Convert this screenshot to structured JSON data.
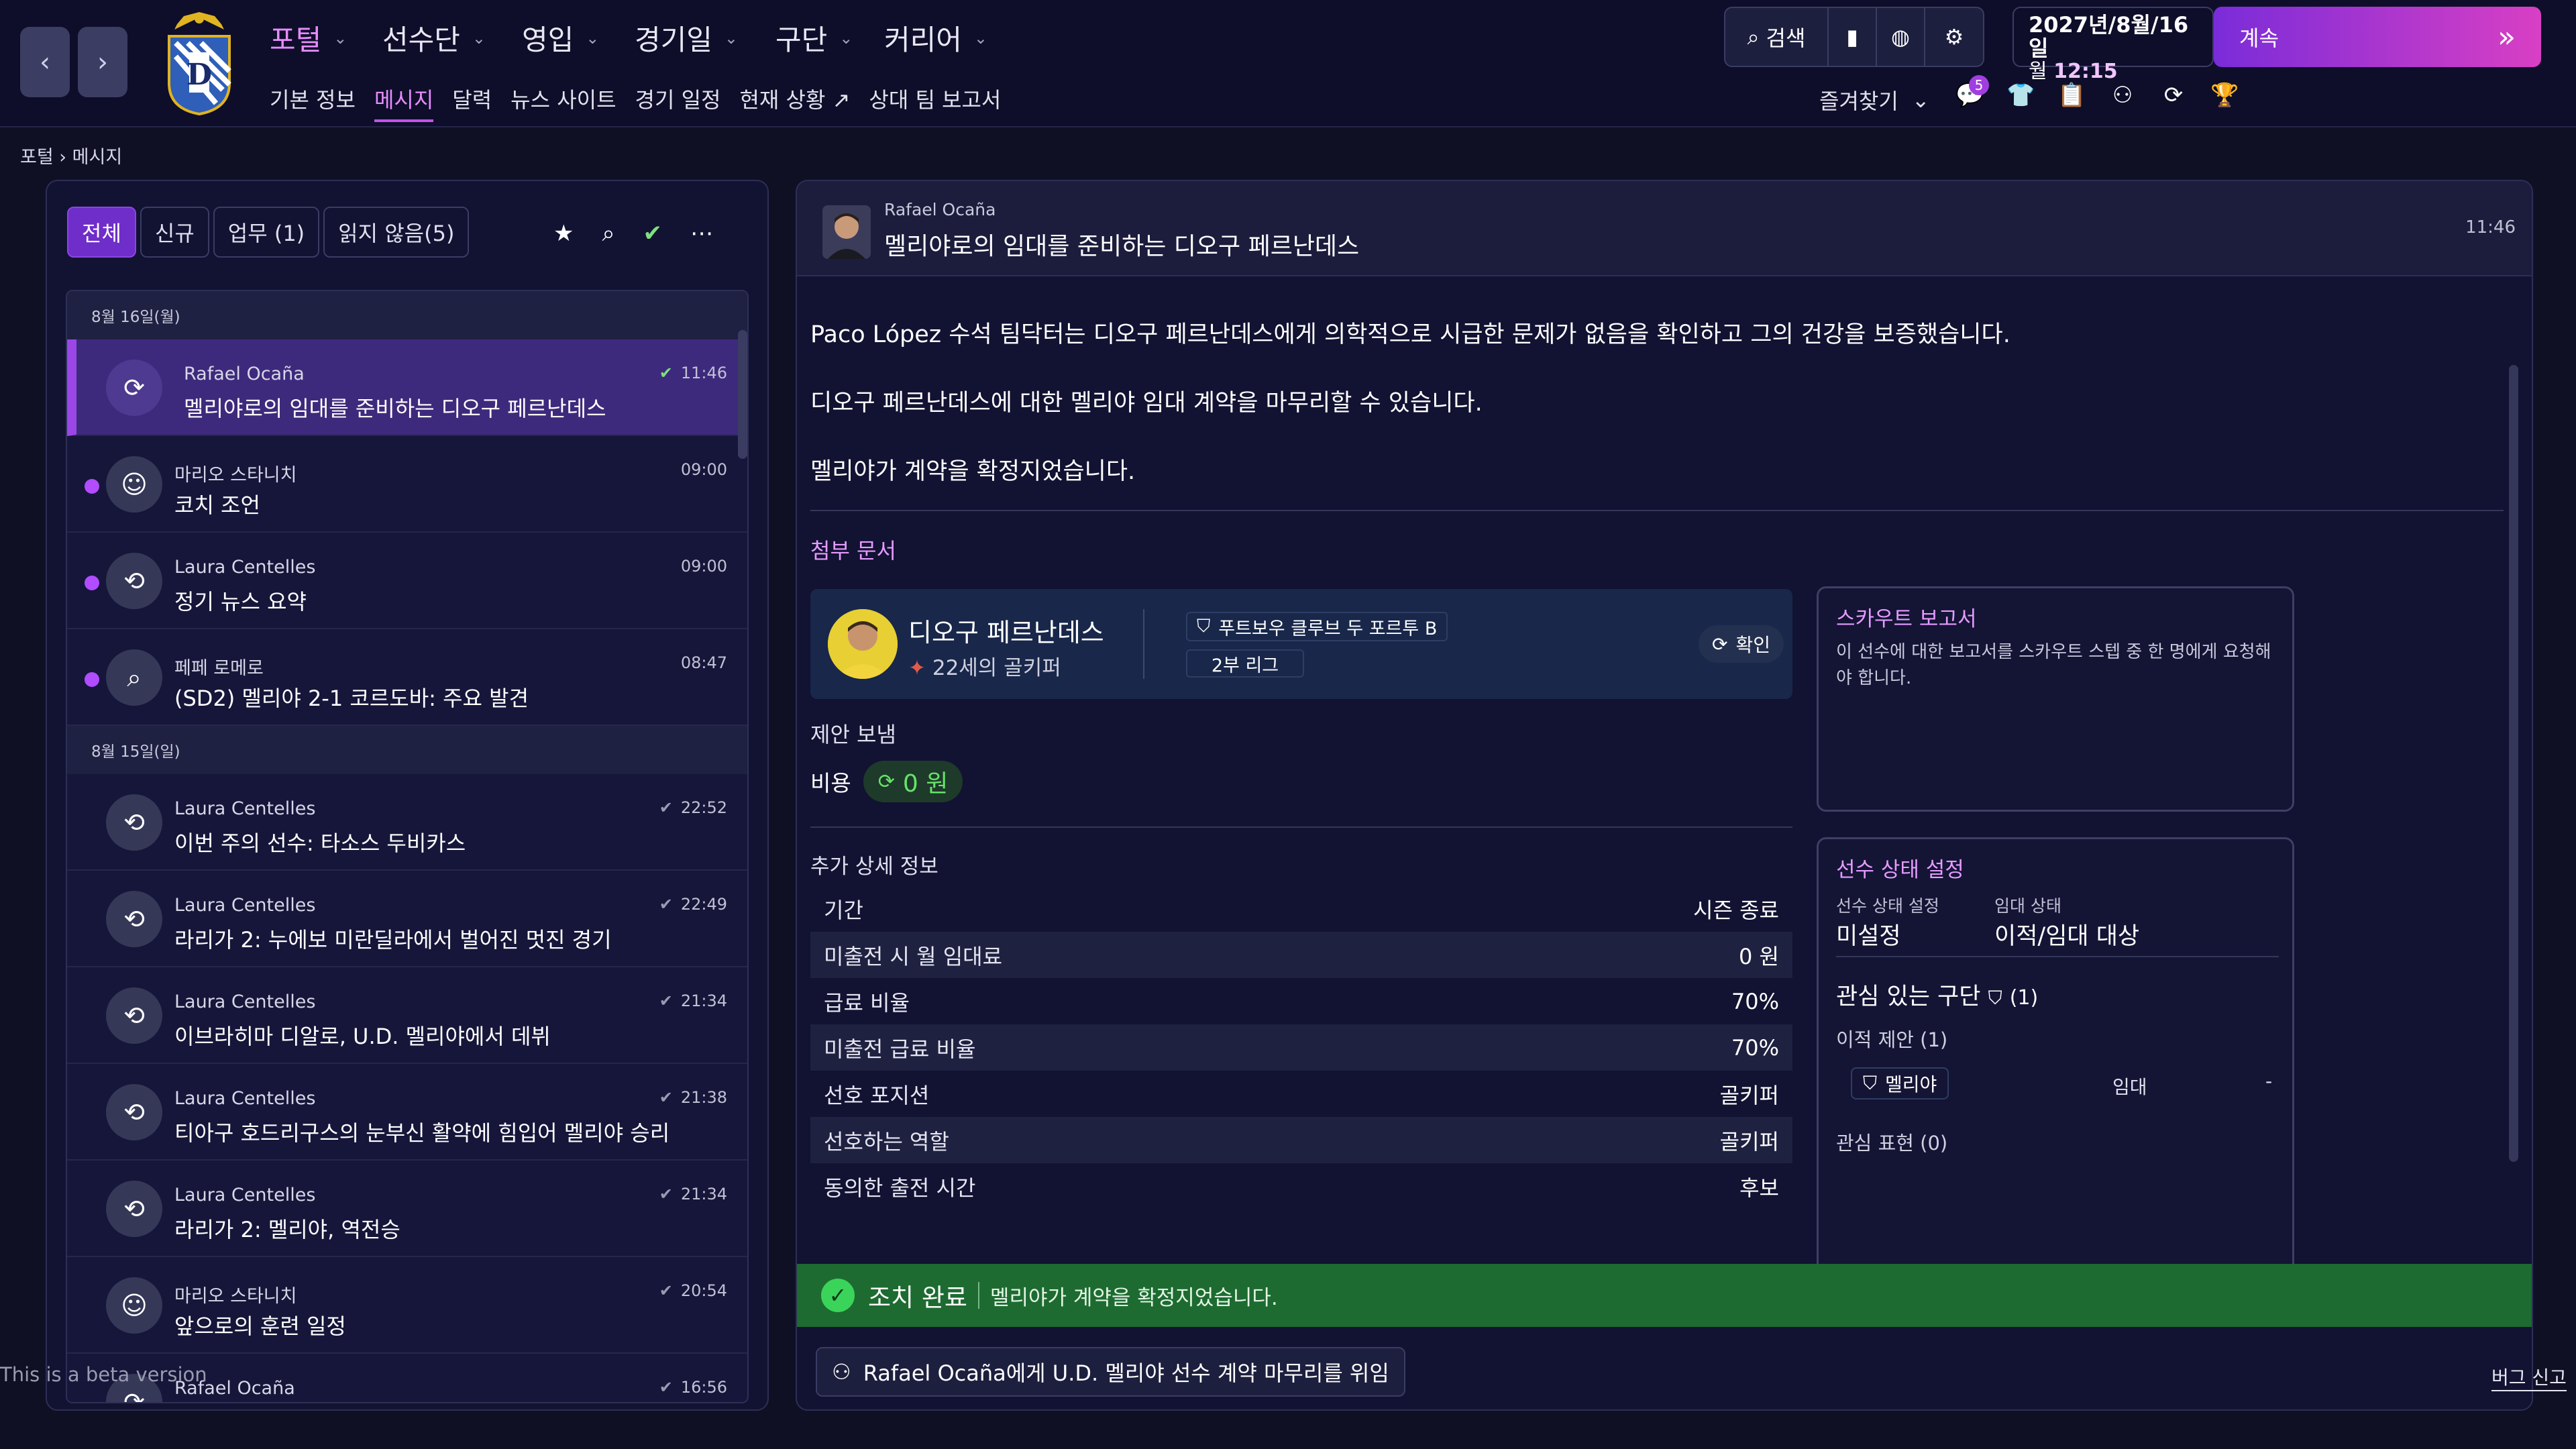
{
  "header": {
    "back_icon": "chevron-left-icon",
    "forward_icon": "chevron-right-icon",
    "main_menu": [
      {
        "label": "포털"
      },
      {
        "label": "선수단"
      },
      {
        "label": "영입"
      },
      {
        "label": "경기일"
      },
      {
        "label": "구단"
      },
      {
        "label": "커리어"
      }
    ],
    "sub_menu": [
      {
        "label": "기본 정보"
      },
      {
        "label": "메시지"
      },
      {
        "label": "달력"
      },
      {
        "label": "뉴스 사이트"
      },
      {
        "label": "경기 일정"
      },
      {
        "label": "현재 상황"
      },
      {
        "label": "상대 팀 보고서"
      }
    ],
    "search_label": "검색",
    "date": "2027년/8월/16일",
    "weekday": "월",
    "time": "12:15",
    "continue_label": "계속",
    "favorites_label": "즐겨찾기",
    "message_count": "5"
  },
  "breadcrumb": {
    "root": "포털",
    "current": "메시지"
  },
  "inbox": {
    "filters": [
      {
        "label": "전체"
      },
      {
        "label": "신규"
      },
      {
        "label": "업무 (1)"
      },
      {
        "label": "읽지 않음(5)"
      }
    ],
    "day_headers": [
      "8월 16일(월)",
      "8월 15일(일)"
    ],
    "messages": [
      {
        "sender": "Rafael Ocaña",
        "subject": "멜리야로의 임대를 준비하는 디오구 페르난데스",
        "time": "11:46",
        "icon": "refresh-icon"
      },
      {
        "sender": "마리오 스타니치",
        "subject": "코치 조언",
        "time": "09:00",
        "icon": "coaches-group-icon"
      },
      {
        "sender": "Laura Centelles",
        "subject": "정기 뉴스 요약",
        "time": "09:00",
        "icon": "news-icon"
      },
      {
        "sender": "페페 로메로",
        "subject": "(SD2) 멜리야 2-1 코르도바: 주요 발견",
        "time": "08:47",
        "icon": "magnifier-icon"
      },
      {
        "sender": "Laura Centelles",
        "subject": "이번 주의 선수: 타소스 두비카스",
        "time": "22:52",
        "icon": "news-icon"
      },
      {
        "sender": "Laura Centelles",
        "subject": "라리가 2: 누에보 미란딜라에서 벌어진 멋진 경기",
        "time": "22:49",
        "icon": "news-icon"
      },
      {
        "sender": "Laura Centelles",
        "subject": "이브라히마 디알로, U.D. 멜리야에서 데뷔",
        "time": "21:34",
        "icon": "news-icon"
      },
      {
        "sender": "Laura Centelles",
        "subject": "티아구 호드리구스의 눈부신 활약에 힘입어 멜리야 승리",
        "time": "21:38",
        "icon": "news-icon"
      },
      {
        "sender": "Laura Centelles",
        "subject": "라리가 2: 멜리야, 역전승",
        "time": "21:34",
        "icon": "news-icon"
      },
      {
        "sender": "마리오 스타니치",
        "subject": "앞으로의 훈련 일정",
        "time": "20:54",
        "icon": "coaches-group-icon"
      },
      {
        "sender": "Rafael Ocaña",
        "subject": "",
        "time": "16:56",
        "icon": "refresh-icon"
      }
    ]
  },
  "detail": {
    "sender": "Rafael Ocaña",
    "subject": "멜리야로의 임대를 준비하는 디오구 페르난데스",
    "time": "11:46",
    "body": [
      "Paco López 수석 팀닥터는 디오구 페르난데스에게 의학적으로 시급한 문제가 없음을 확인하고 그의 건강을 보증했습니다.",
      "디오구 페르난데스에 대한 멜리야 임대 계약을 마무리할 수 있습니다.",
      "멜리야가 계약을 확정지었습니다."
    ],
    "attachments_title": "첨부 문서",
    "player": {
      "name": "디오구 페르난데스",
      "info": "22세의 골키퍼",
      "club": "푸트보우 클루브 두 포르투 B",
      "league": "2부 리그",
      "confirm_label": "확인"
    },
    "offer_label": "제안 보냄",
    "cost_label": "비용",
    "cost_value": "0 원",
    "additional_title": "추가 상세 정보",
    "details": [
      {
        "label": "기간",
        "value": "시즌 종료"
      },
      {
        "label": "미출전 시 월 임대료",
        "value": "0 원"
      },
      {
        "label": "급료 비율",
        "value": "70%"
      },
      {
        "label": "미출전 급료 비율",
        "value": "70%"
      },
      {
        "label": "선호 포지션",
        "value": "골키퍼"
      },
      {
        "label": "선호하는 역할",
        "value": "골키퍼"
      },
      {
        "label": "동의한 출전 시간",
        "value": "후보"
      }
    ],
    "scout": {
      "title": "스카우트 보고서",
      "desc": "이 선수에 대한 보고서를 스카우트 스텝 중 한 명에게 요청해야 합니다."
    },
    "status": {
      "title": "선수 상태 설정",
      "status_label": "선수 상태 설정",
      "status_value": "미설정",
      "loan_label": "임대 상태",
      "loan_value": "이적/임대 대상",
      "interest_title": "관심 있는 구단",
      "interest_count": "(1)",
      "transfer_offers": "이적 제안 (1)",
      "club_name": "멜리야",
      "offer_type": "임대",
      "offer_value": "-",
      "interest_expressed": "관심 표현 (0)"
    },
    "action_done": "조치 완료",
    "action_text": "멜리야가 계약을 확정지었습니다.",
    "delegate_label": "Rafael Ocaña에게 U.D. 멜리야 선수 계약 마무리를 위임"
  },
  "footer": {
    "beta": "This is a beta version",
    "bug_report": "버그 신고"
  },
  "colors": {
    "accent": "#c553ea",
    "selected_row": "#3e2a7c",
    "success": "#1d6b30",
    "cost_green": "#66e36a"
  }
}
